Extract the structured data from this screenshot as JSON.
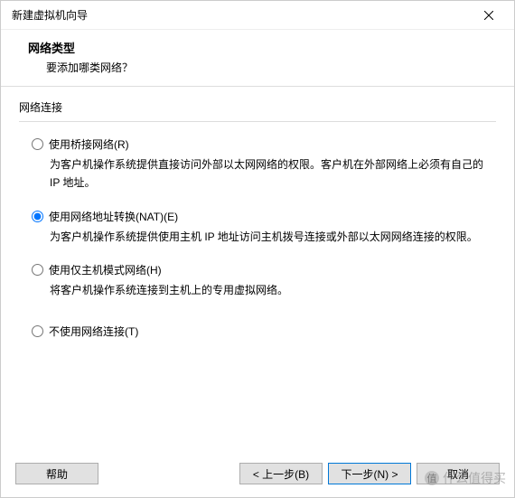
{
  "window": {
    "title": "新建虚拟机向导"
  },
  "header": {
    "title": "网络类型",
    "subtitle": "要添加哪类网络？"
  },
  "group": {
    "label": "网络连接"
  },
  "options": {
    "bridged": {
      "label": "使用桥接网络(R)",
      "desc": "为客户机操作系统提供直接访问外部以太网网络的权限。客户机在外部网络上必须有自己的 IP 地址。"
    },
    "nat": {
      "label": "使用网络地址转换(NAT)(E)",
      "desc": "为客户机操作系统提供使用主机 IP 地址访问主机拨号连接或外部以太网网络连接的权限。"
    },
    "hostonly": {
      "label": "使用仅主机模式网络(H)",
      "desc": "将客户机操作系统连接到主机上的专用虚拟网络。"
    },
    "none": {
      "label": "不使用网络连接(T)"
    }
  },
  "buttons": {
    "help": "帮助",
    "back": "< 上一步(B)",
    "next": "下一步(N) >",
    "cancel": "取消"
  },
  "watermark": {
    "text": "什么值得买"
  }
}
